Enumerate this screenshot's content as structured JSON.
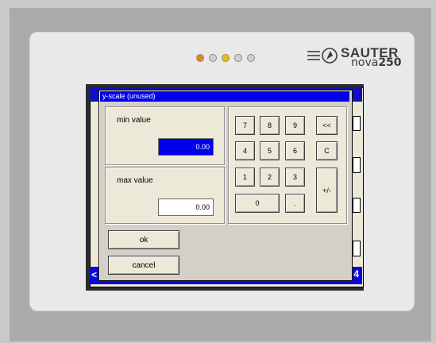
{
  "brand": {
    "name": "SAUTER",
    "model": "nova",
    "version": "250"
  },
  "leds": [
    {
      "color": "#e08a1a"
    },
    {
      "color": "#d0d0d0"
    },
    {
      "color": "#e6c000"
    },
    {
      "color": "#d0d0d0"
    },
    {
      "color": "#d0d0d0"
    }
  ],
  "background": {
    "bottom_arrow": "<",
    "bottom_number": "4"
  },
  "dialog": {
    "title": "y-scale (unused)",
    "min_label": "min value",
    "min_value": "0.00",
    "max_label": "max value",
    "max_value": "0.00",
    "ok_label": "ok",
    "cancel_label": "cancel"
  },
  "keypad": {
    "k7": "7",
    "k8": "8",
    "k9": "9",
    "back": "<<",
    "k4": "4",
    "k5": "5",
    "k6": "6",
    "clear": "C",
    "k1": "1",
    "k2": "2",
    "k3": "3",
    "sign": "+/-",
    "k0": "0",
    "dot": "."
  },
  "colors": {
    "title_bar": "#0000ee",
    "selected_field": "#0000ee",
    "dialog_bg": "#ece9d8"
  }
}
